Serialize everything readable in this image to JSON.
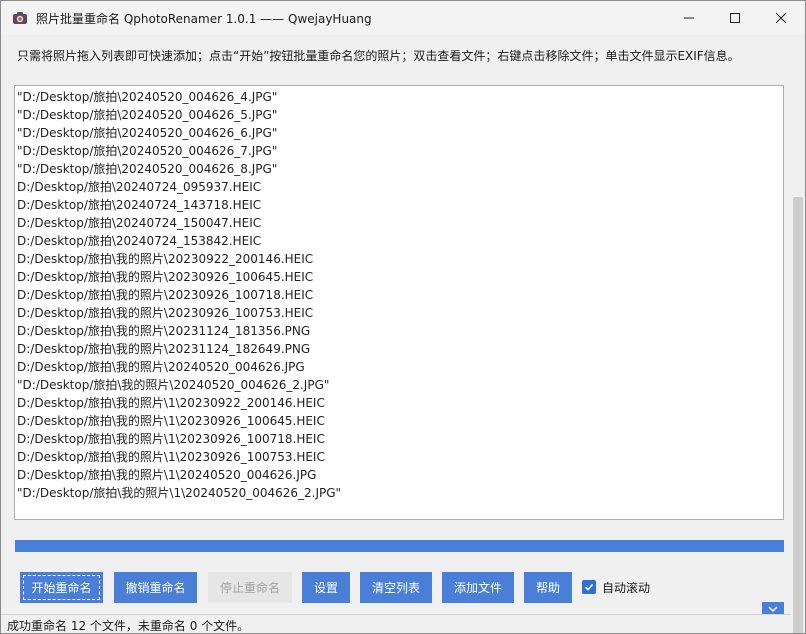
{
  "window": {
    "title": "照片批量重命名 QphotoRenamer 1.0.1 —— QwejayHuang",
    "icons": {
      "app": "camera-app-icon",
      "minimize": "minimize-icon",
      "maximize": "maximize-icon",
      "close": "close-icon"
    }
  },
  "hint": "只需将照片拖入列表即可快速添加；点击“开始”按钮批量重命名您的照片；双击查看文件；右键点击移除文件；单击文件显示EXIF信息。",
  "files": [
    "\"D:/Desktop/旅拍\\20240520_004626_4.JPG\"",
    "\"D:/Desktop/旅拍\\20240520_004626_5.JPG\"",
    "\"D:/Desktop/旅拍\\20240520_004626_6.JPG\"",
    "\"D:/Desktop/旅拍\\20240520_004626_7.JPG\"",
    "\"D:/Desktop/旅拍\\20240520_004626_8.JPG\"",
    "D:/Desktop/旅拍\\20240724_095937.HEIC",
    "D:/Desktop/旅拍\\20240724_143718.HEIC",
    "D:/Desktop/旅拍\\20240724_150047.HEIC",
    "D:/Desktop/旅拍\\20240724_153842.HEIC",
    "D:/Desktop/旅拍\\我的照片\\20230922_200146.HEIC",
    "D:/Desktop/旅拍\\我的照片\\20230926_100645.HEIC",
    "D:/Desktop/旅拍\\我的照片\\20230926_100718.HEIC",
    "D:/Desktop/旅拍\\我的照片\\20230926_100753.HEIC",
    "D:/Desktop/旅拍\\我的照片\\20231124_181356.PNG",
    "D:/Desktop/旅拍\\我的照片\\20231124_182649.PNG",
    "D:/Desktop/旅拍\\我的照片\\20240520_004626.JPG",
    "\"D:/Desktop/旅拍\\我的照片\\20240520_004626_2.JPG\"",
    "D:/Desktop/旅拍\\我的照片\\1\\20230922_200146.HEIC",
    "D:/Desktop/旅拍\\我的照片\\1\\20230926_100645.HEIC",
    "D:/Desktop/旅拍\\我的照片\\1\\20230926_100718.HEIC",
    "D:/Desktop/旅拍\\我的照片\\1\\20230926_100753.HEIC",
    "D:/Desktop/旅拍\\我的照片\\1\\20240520_004626.JPG",
    "\"D:/Desktop/旅拍\\我的照片\\1\\20240520_004626_2.JPG\""
  ],
  "progress": {
    "fraction": 1.0,
    "color": "#4a7fd8"
  },
  "buttons": {
    "start": "开始重命名",
    "undo": "撤销重命名",
    "stop": "停止重命名",
    "settings": "设置",
    "clear": "清空列表",
    "add": "添加文件",
    "help": "帮助"
  },
  "auto_scroll": {
    "label": "自动滚动",
    "checked": true,
    "icon": "checkmark-icon"
  },
  "status": "成功重命名 12 个文件，未重命名 0 个文件。",
  "colors": {
    "accent": "#4a7fd8",
    "disabled_bg": "#e6e6e6",
    "disabled_text": "#a0a0a0"
  }
}
